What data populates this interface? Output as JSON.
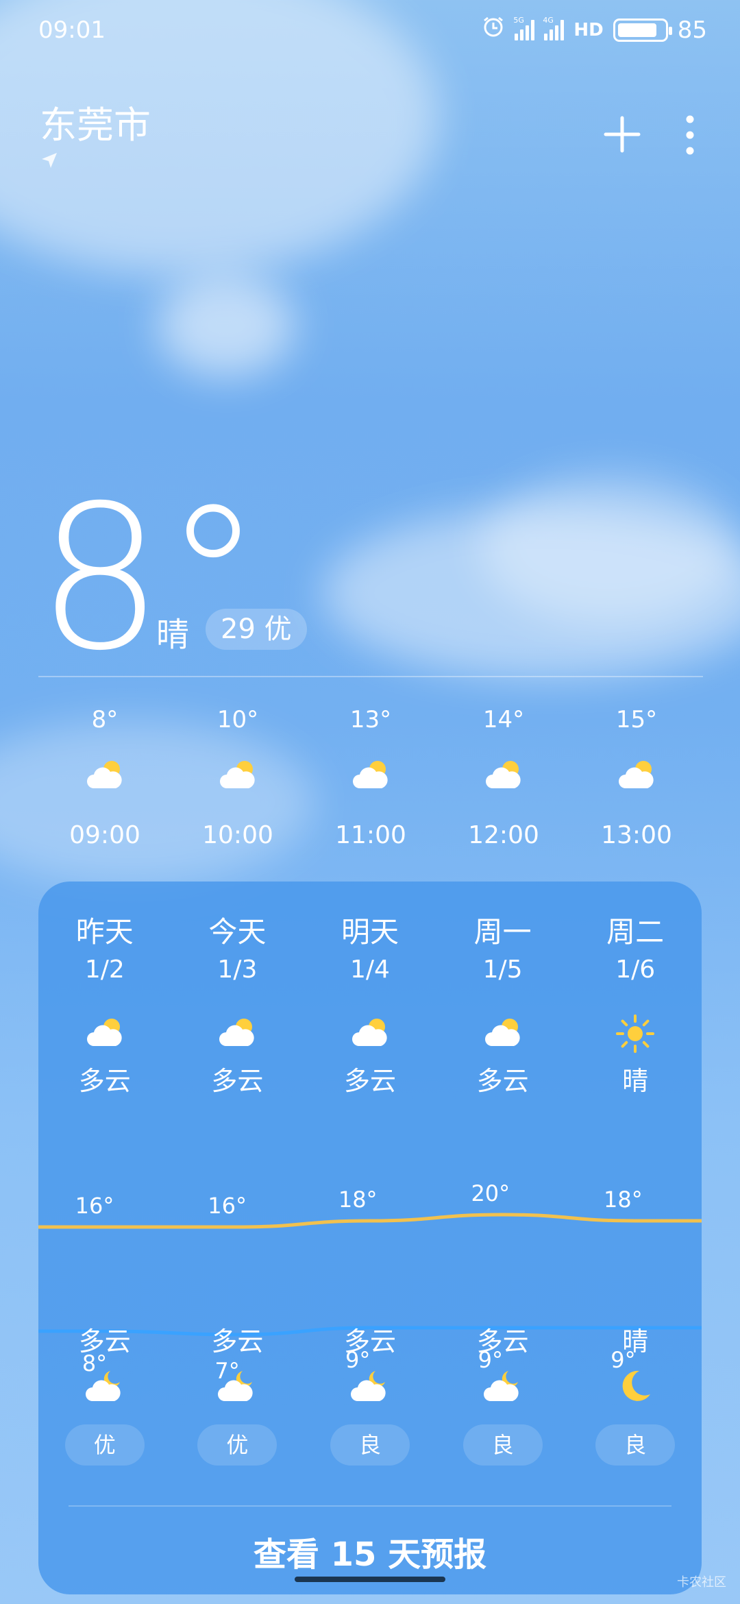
{
  "status_bar": {
    "time": "09:01",
    "net1": "5G",
    "net2": "4G",
    "hd": "HD",
    "battery": "85",
    "battery_level": 0.85
  },
  "header": {
    "city": "东莞市"
  },
  "current": {
    "temperature": "8°",
    "condition": "晴",
    "aqi": "29 优"
  },
  "hourly": [
    {
      "temp": "8°",
      "time": "09:00",
      "icon": "partly-cloudy-icon"
    },
    {
      "temp": "10°",
      "time": "10:00",
      "icon": "partly-cloudy-icon"
    },
    {
      "temp": "13°",
      "time": "11:00",
      "icon": "partly-cloudy-icon"
    },
    {
      "temp": "14°",
      "time": "12:00",
      "icon": "partly-cloudy-icon"
    },
    {
      "temp": "15°",
      "time": "13:00",
      "icon": "partly-cloudy-icon"
    }
  ],
  "daily": [
    {
      "name": "昨天",
      "date": "1/2",
      "day_cond": "多云",
      "day_icon": "partly-cloudy-icon",
      "high": "16°",
      "low": "8°",
      "night_cond": "多云",
      "night_icon": "cloudy-night-icon",
      "aqi": "优"
    },
    {
      "name": "今天",
      "date": "1/3",
      "day_cond": "多云",
      "day_icon": "partly-cloudy-icon",
      "high": "16°",
      "low": "7°",
      "night_cond": "多云",
      "night_icon": "cloudy-night-icon",
      "aqi": "优"
    },
    {
      "name": "明天",
      "date": "1/4",
      "day_cond": "多云",
      "day_icon": "partly-cloudy-icon",
      "high": "18°",
      "low": "9°",
      "night_cond": "多云",
      "night_icon": "cloudy-night-icon",
      "aqi": "良"
    },
    {
      "name": "周一",
      "date": "1/5",
      "day_cond": "多云",
      "day_icon": "partly-cloudy-icon",
      "high": "20°",
      "low": "9°",
      "night_cond": "多云",
      "night_icon": "cloudy-night-icon",
      "aqi": "良"
    },
    {
      "name": "周二",
      "date": "1/6",
      "day_cond": "晴",
      "day_icon": "sun-icon",
      "high": "18°",
      "low": "9°",
      "night_cond": "晴",
      "night_icon": "moon-icon",
      "aqi": "良"
    }
  ],
  "chart_data": {
    "type": "line",
    "categories": [
      "昨天",
      "今天",
      "明天",
      "周一",
      "周二"
    ],
    "series": [
      {
        "values": [
          16,
          16,
          18,
          20,
          18
        ],
        "color": "#f2c14e"
      },
      {
        "values": [
          8,
          7,
          9,
          9,
          9
        ],
        "color": "#3aa2ff"
      }
    ]
  },
  "footer": {
    "forecast_link": "查看 15 天预报"
  },
  "watermark": "卡农社区",
  "colors": {
    "high_line": "#f2c14e",
    "low_line": "#3aa2ff",
    "sun": "#ffcf3d"
  }
}
